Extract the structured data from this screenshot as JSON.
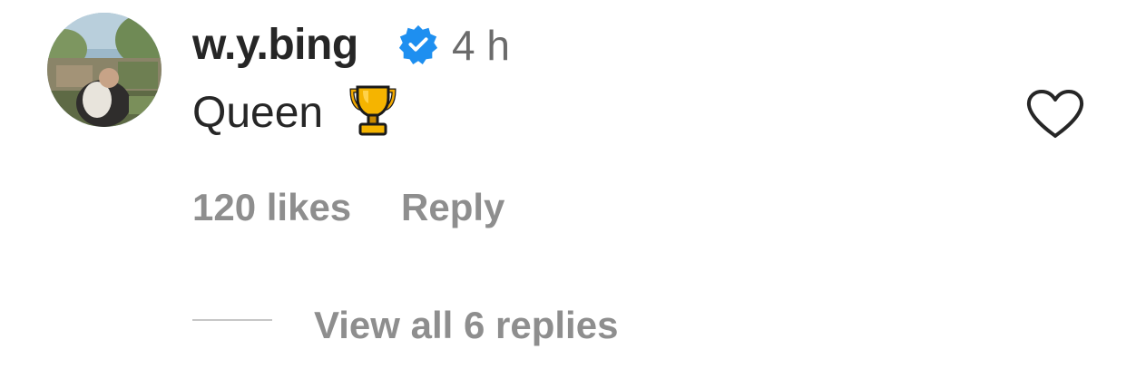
{
  "comment": {
    "username": "w.y.bing",
    "verified_icon": "verified-badge-icon",
    "time_ago": "4 h",
    "text": "Queen",
    "emoji_icon": "trophy-icon",
    "like_icon": "heart-outline-icon",
    "likes_label": "120 likes",
    "reply_label": "Reply",
    "view_replies_label": "View all 6 replies"
  },
  "colors": {
    "verified_blue": "#1e8ff0",
    "primary_text": "#262626",
    "secondary_text": "#8e8e8e"
  }
}
